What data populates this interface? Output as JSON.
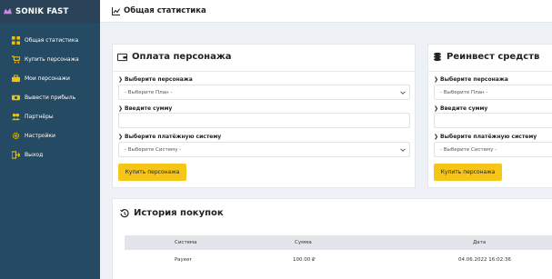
{
  "brand": {
    "name": "SONIK FAST"
  },
  "sidebar": {
    "items": [
      {
        "label": "Общая статистика",
        "icon": "dashboard-icon"
      },
      {
        "label": "Купить персонажа",
        "icon": "cart-icon"
      },
      {
        "label": "Мои персонажи",
        "icon": "characters-icon"
      },
      {
        "label": "Вывести прибыль",
        "icon": "withdraw-icon"
      },
      {
        "label": "Партнёры",
        "icon": "partners-icon"
      },
      {
        "label": "Настройки",
        "icon": "settings-icon"
      },
      {
        "label": "Выход",
        "icon": "logout-icon"
      }
    ]
  },
  "header": {
    "title": "Общая статистика"
  },
  "payment": {
    "title": "Оплата персонажа",
    "character_label": "Выберите персонажа",
    "character_value": "- Выберите План -",
    "amount_label": "Введите сумму",
    "amount_value": "",
    "system_label": "Выберите платёжную систему",
    "system_value": "- Выберите Систему -",
    "button": "Купить персонажа"
  },
  "reinvest": {
    "title": "Реинвест средств",
    "character_label": "Выберите персонажа",
    "character_value": "- Выберите План -",
    "amount_label": "Введите сумму",
    "amount_value": "",
    "system_label": "Выберите платёжную систему",
    "system_value": "- Выберите Систему -",
    "button": "Купить персонажа"
  },
  "history": {
    "title": "История покупок",
    "columns": [
      "Система",
      "Сумма",
      "Дата"
    ],
    "rows": [
      {
        "system": "Payeer",
        "amount": "100.00 ₽",
        "date": "04.06.2022 16:02:36"
      }
    ]
  },
  "colors": {
    "sidebar": "#254a63",
    "brand_bar": "#2a4358",
    "accent": "#f5c518",
    "icon_yellow": "#f2c200"
  }
}
